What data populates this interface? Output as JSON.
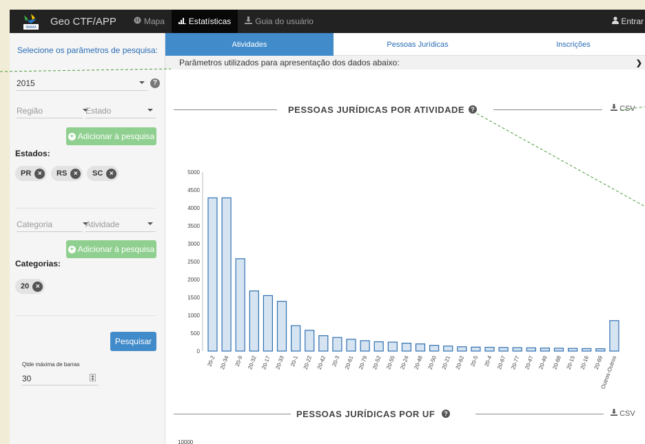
{
  "navbar": {
    "brand": "Geo CTF/APP",
    "logo_text": "IBAMA",
    "items": [
      {
        "label": "Mapa",
        "icon": "globe-icon",
        "active": false
      },
      {
        "label": "Estatísticas",
        "icon": "bar-chart-icon",
        "active": true
      },
      {
        "label": "Guia do usuário",
        "icon": "download-icon",
        "active": false
      }
    ],
    "login_label": "Entrar"
  },
  "sidebar": {
    "title": "Selecione os parâmetros de pesquisa:",
    "year_value": "2015",
    "region_placeholder": "Região",
    "state_placeholder": "Estado",
    "add_label": "Adicionar à pesquisa",
    "states_label": "Estados:",
    "states": [
      "PR",
      "RS",
      "SC"
    ],
    "category_placeholder": "Categoria",
    "activity_placeholder": "Atividade",
    "add_label_2": "Adicionar à pesquisa",
    "categories_label": "Categorias:",
    "categories": [
      "20"
    ],
    "search_label": "Pesquisar",
    "max_bars_label": "Qtde máxima de barras",
    "max_bars_value": "30"
  },
  "main": {
    "tabs": [
      "Atividades",
      "Pessoas Jurídicas",
      "Inscrições"
    ],
    "active_tab": 0,
    "params_text": "Parâmetros utilizados para apresentação dos dados abaixo:",
    "chart1_title": "PESSOAS JURÍDICAS POR ATIVIDADE",
    "chart2_title": "PESSOAS JURÍDICAS POR UF",
    "csv_label": "CSV",
    "chart2_first_tick": "10000"
  },
  "colors": {
    "navbar": "#222222",
    "tab_active": "#428bca",
    "bar_fill": "#d6e4f2",
    "bar_stroke": "#2f6fb0",
    "add_button": "#8fcf8f"
  },
  "chart_data": {
    "type": "bar",
    "title": "PESSOAS JURÍDICAS POR ATIVIDADE",
    "categories": [
      "20-2",
      "20-34",
      "20-9",
      "20-32",
      "20-17",
      "20-33",
      "20-1",
      "20-22",
      "20-42",
      "20-3",
      "20-61",
      "20-79",
      "20-52",
      "20-55",
      "20-24",
      "20-48",
      "20-50",
      "20-21",
      "20-62",
      "20-5",
      "20-4",
      "20-67",
      "20-77",
      "20-47",
      "20-49",
      "20-68",
      "20-15",
      "20-16",
      "20-69",
      "Outros-Outros"
    ],
    "values": [
      4280,
      4280,
      2580,
      1680,
      1550,
      1390,
      710,
      580,
      430,
      380,
      330,
      290,
      260,
      250,
      220,
      200,
      160,
      140,
      120,
      110,
      105,
      100,
      95,
      90,
      85,
      80,
      75,
      70,
      65,
      850
    ],
    "yticks": [
      0,
      500,
      1000,
      1500,
      2000,
      2500,
      3000,
      3500,
      4000,
      4500,
      5000
    ],
    "ylim": [
      0,
      5000
    ],
    "grid": false
  }
}
